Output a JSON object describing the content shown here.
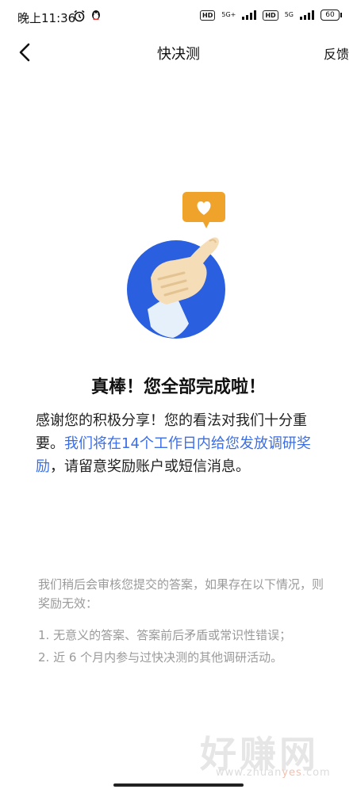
{
  "status_bar": {
    "time": "晚上11:36",
    "sim1": {
      "hd": "HD",
      "network": "5G+"
    },
    "sim2": {
      "hd": "HD",
      "network": "5G"
    },
    "battery": "60"
  },
  "nav": {
    "title": "快决测",
    "feedback_label": "反馈",
    "back_icon": "chevron-left-icon"
  },
  "illustration": {
    "heart_color": "#f0a32a",
    "circle_color": "#2a5fe0"
  },
  "result": {
    "heading": "真棒！您全部完成啦！",
    "message_start": "感谢您的积极分享！您的看法对我们十分重要。",
    "message_highlight": "我们将在14个工作日内给您发放调研奖励",
    "message_end": "，请留意奖励账户或短信消息。"
  },
  "notice": {
    "intro": "我们稍后会审核您提交的答案，如果存在以下情况，则奖励无效：",
    "items": [
      "1. 无意义的答案、答案前后矛盾或常识性错误；",
      "2. 近 6 个月内参与过快决测的其他调研活动。"
    ]
  },
  "watermark": {
    "main": "好赚网",
    "sub_prefix": "www.zhuan",
    "sub_accent": "yes",
    "sub_suffix": ".com"
  }
}
